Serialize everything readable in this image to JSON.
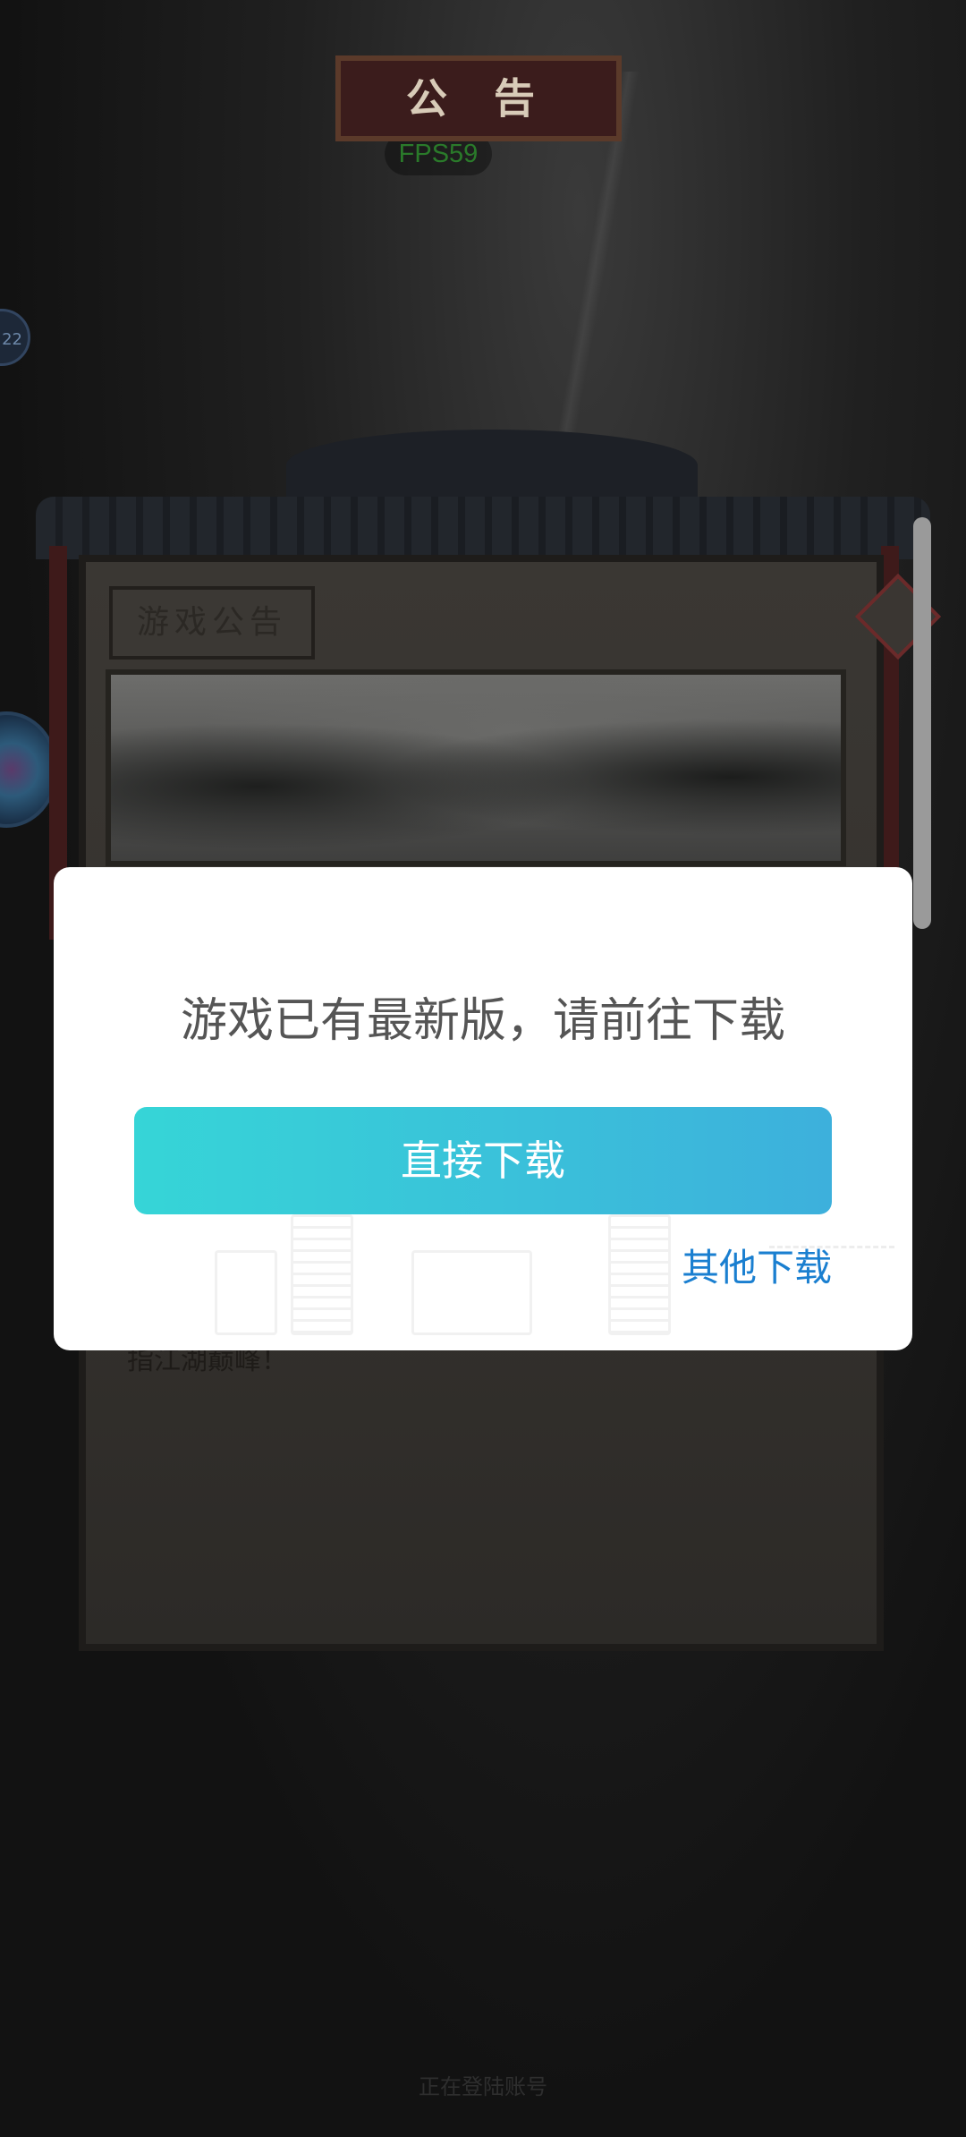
{
  "hud": {
    "fps_label": "FPS59",
    "side_badge_text": "22"
  },
  "board": {
    "title": "公 告",
    "tag": "游戏公告",
    "text_fragment": "指江湖巅峰！"
  },
  "status": {
    "footer": "正在登陆账号"
  },
  "dialog": {
    "message": "游戏已有最新版，请前往下载",
    "primary_button": "直接下载",
    "secondary_link": "其他下载"
  },
  "colors": {
    "primary_gradient_start": "#36d5d7",
    "primary_gradient_end": "#3db0dc",
    "link": "#1a7fd0",
    "message_text": "#555555",
    "fps_text": "#2a7a2a"
  }
}
